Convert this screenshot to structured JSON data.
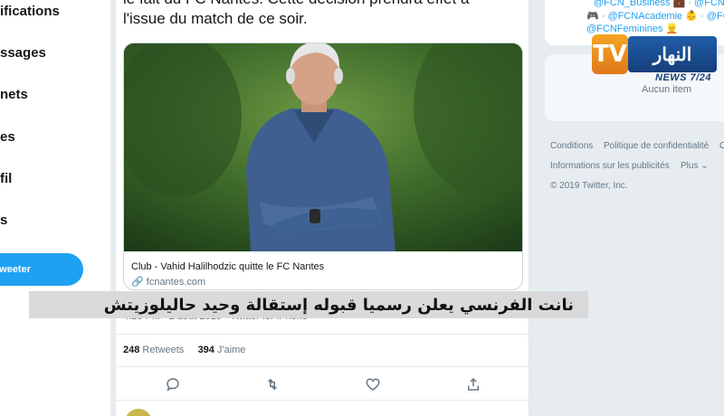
{
  "left_nav": {
    "items": [
      {
        "label": "ifications"
      },
      {
        "label": "ssages"
      },
      {
        "label": "nets"
      },
      {
        "label": "es"
      },
      {
        "label": "fil"
      },
      {
        "label": "s"
      }
    ],
    "tweet_button": "weeter"
  },
  "tweet": {
    "text_line1": "le fait du FC Nantes. Cette décision prendra effet à",
    "text_line2": "l'issue du match de ce soir.",
    "card": {
      "title": "Club - Vahid Halilhodzic quitte le FC Nantes",
      "url": "fcnantes.com"
    },
    "timestamp": "4:20 PM · 2 août 2019 · Twitter for iPhone",
    "retweets_count": "248",
    "retweets_label": "Retweets",
    "likes_count": "394",
    "likes_label": "J'aime"
  },
  "sidebar": {
    "trend_line1": "@FCN_Business 💼 · @FCNA",
    "trend_line2": "🎮 · @FCNAcademie 👶 · @FCNA",
    "trend_line3": "@FCNFeminines 👱",
    "empty_label": "Aucun item",
    "footer": {
      "conditions": "Conditions",
      "privacy": "Politique de confidentialité",
      "privacy_tail": "C",
      "ads_info": "Informations sur les publicités",
      "more": "Plus",
      "copyright": "© 2019 Twitter, Inc."
    }
  },
  "broadcast": {
    "logo_tv": "TV",
    "logo_name": "النهار",
    "logo_sub": "NEWS 7/24",
    "ticker": "نانت الفرنسي يعلن رسميا قبوله إستقالة وحيد حاليلوزيتش"
  },
  "colors": {
    "twitter_blue": "#1da1f2",
    "logo_orange": "#f5a623",
    "logo_blue": "#1f5da8"
  }
}
